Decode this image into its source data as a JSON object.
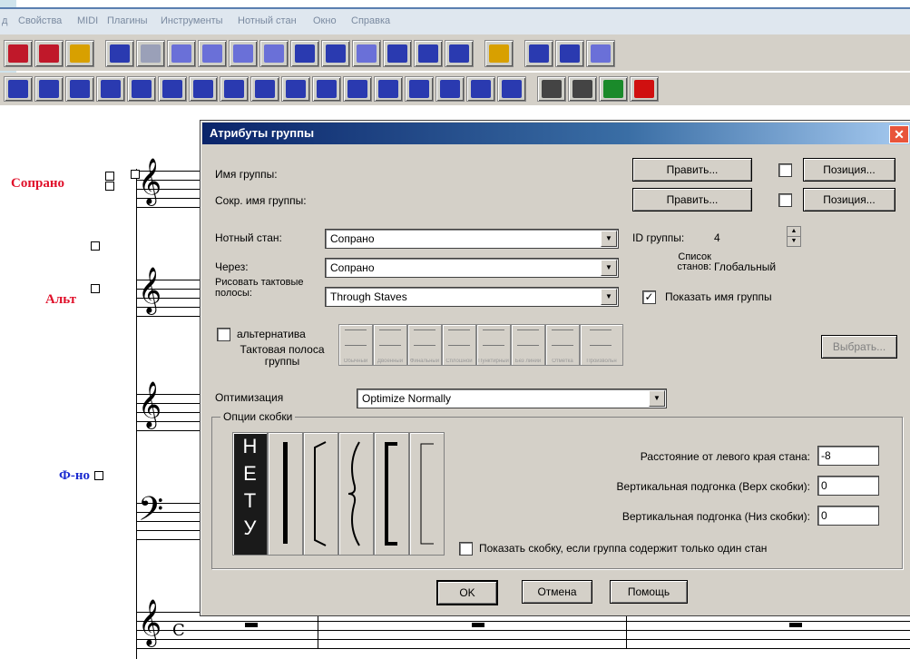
{
  "menu": [
    "д",
    "Свойства",
    "MIDI",
    "Плагины",
    "Инструменты",
    "Нотный стан",
    "Окно",
    "Справка"
  ],
  "score": {
    "labels": {
      "soprano": "Сопрано",
      "alto": "Альт",
      "piano": "Ф-но"
    },
    "label_colors": {
      "soprano": "#e0102a",
      "alto": "#e0102a",
      "piano": "#1a2ad0"
    },
    "time_signature": "C"
  },
  "dialog": {
    "title": "Атрибуты группы",
    "close": "✕",
    "group_name_label": "Имя группы:",
    "short_group_name_label": "Сокр. имя группы:",
    "edit_button": "Править...",
    "position_button": "Позиция...",
    "staff_label": "Нотный стан:",
    "staff_value": "Сопрано",
    "through_label": "Через:",
    "through_value": "Сопрано",
    "draw_barlines_label": "Рисовать тактовые полосы:",
    "draw_barlines_value": "Through Staves",
    "group_id_label": "ID группы:",
    "group_id_value": "4",
    "staff_list_label": "Список станов:",
    "staff_list_value": "Глобальный",
    "show_group_name_label": "Показать имя группы",
    "alternative_label": "альтернатива",
    "group_barline_label": "Тактовая полоса группы",
    "barline_styles": [
      "Обычный",
      "Двоенный",
      "Финальный",
      "Сплошной",
      "Пунктирный",
      "Без линии",
      "Отметка",
      "Произвольн"
    ],
    "select_button": "Выбрать...",
    "optimization_label": "Оптимизация",
    "optimization_value": "Optimize Normally",
    "bracket_options_label": "Опции скобки",
    "none_bracket_letters": [
      "Н",
      "Е",
      "Т",
      "У"
    ],
    "distance_label": "Расстояние от левого края стана:",
    "distance_value": "-8",
    "vadjust_top_label": "Вертикальная подгонка (Верх скобки):",
    "vadjust_top_value": "0",
    "vadjust_bottom_label": "Вертикальная подгонка (Низ скобки):",
    "vadjust_bottom_value": "0",
    "show_bracket_single_label": "Показать скобку, если группа содержит только один стан",
    "ok": "OK",
    "cancel": "Отмена",
    "help": "Помощь"
  },
  "colors": {
    "title_start": "#0a246a",
    "title_end": "#a6caf0",
    "dialog_bg": "#d4d0c8"
  }
}
